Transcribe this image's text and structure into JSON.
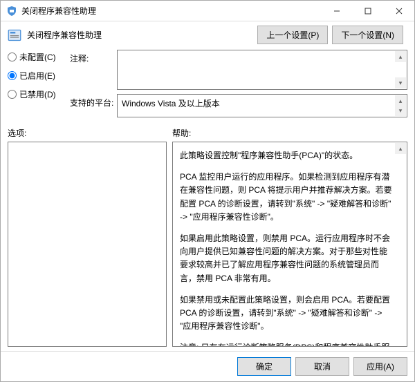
{
  "window": {
    "title": "关闭程序兼容性助理"
  },
  "header": {
    "title": "关闭程序兼容性助理",
    "prev": "上一个设置(P)",
    "next": "下一个设置(N)"
  },
  "radios": {
    "not_configured": "未配置(C)",
    "enabled": "已启用(E)",
    "disabled": "已禁用(D)",
    "selected": "enabled"
  },
  "fields": {
    "comment_label": "注释:",
    "comment_value": "",
    "platforms_label": "支持的平台:",
    "platforms_value": "Windows Vista 及以上版本"
  },
  "sections": {
    "options": "选项:",
    "help": "帮助:"
  },
  "help": {
    "p1": "此策略设置控制\"程序兼容性助手(PCA)\"的状态。",
    "p2": "PCA 监控用户运行的应用程序。如果检测到应用程序有潜在兼容性问题，则 PCA 将提示用户并推荐解决方案。若要配置 PCA 的诊断设置，请转到\"系统\" -> \"疑难解答和诊断\" -> \"应用程序兼容性诊断\"。",
    "p3": "如果启用此策略设置，则禁用 PCA。运行应用程序时不会向用户提供已知兼容性问题的解决方案。对于那些对性能要求较高并已了解应用程序兼容性问题的系统管理员而言，禁用 PCA 非常有用。",
    "p4": "如果禁用或未配置此策略设置，则会启用 PCA。若要配置 PCA 的诊断设置，请转到\"系统\" -> \"疑难解答和诊断\" -> \"应用程序兼容性诊断\"。",
    "p5": "注意: 只有在运行诊断策略服务(DPS)和程序兼容性助手服务后，才能运行 PCA。可以使用服务管理单元将这些服务配置到 Microsoft 管理控制台。"
  },
  "footer": {
    "ok": "确定",
    "cancel": "取消",
    "apply": "应用(A)"
  }
}
